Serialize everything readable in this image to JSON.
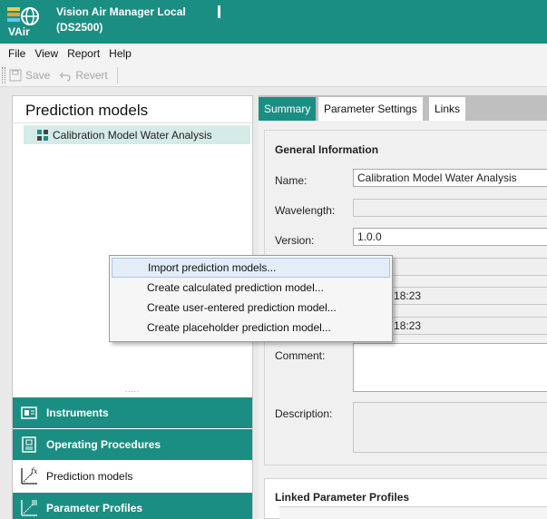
{
  "app": {
    "title_line1": "Vision Air Manager Local",
    "title_line2": "(DS2500)",
    "brand_color": "#1b8e83",
    "logo_icon": "vision-air-logo-icon"
  },
  "menu": [
    "File",
    "View",
    "Report",
    "Help"
  ],
  "toolbar": {
    "save_label": "Save",
    "revert_label": "Revert"
  },
  "left_panel": {
    "title": "Prediction models",
    "tree_item": "Calibration Model Water Analysis",
    "splitter": ".....",
    "nav": [
      {
        "label": "Instruments",
        "icon": "instruments-icon",
        "active": false
      },
      {
        "label": "Operating Procedures",
        "icon": "operating-procedures-icon",
        "active": false
      },
      {
        "label": "Prediction models",
        "icon": "prediction-models-icon",
        "active": true
      },
      {
        "label": "Parameter Profiles",
        "icon": "parameter-profiles-icon",
        "active": false
      }
    ]
  },
  "tabs": [
    "Summary",
    "Parameter Settings",
    "Links"
  ],
  "general": {
    "title": "General Information",
    "name_label": "Name:",
    "name_value": "Calibration Model Water Analysis",
    "wavelength_label": "Wavelength:",
    "wavelength_value": "",
    "version_label": "Version:",
    "version_value": "1.0.0",
    "created_value": "017 08:18:23",
    "modified_value": "017 08:18:23",
    "comment_label": "Comment:",
    "description_label": "Description:"
  },
  "linked": {
    "title": "Linked Parameter Profiles"
  },
  "context_menu": [
    "Import prediction models...",
    "Create calculated prediction model...",
    "Create user-entered prediction model...",
    "Create placeholder prediction model..."
  ]
}
